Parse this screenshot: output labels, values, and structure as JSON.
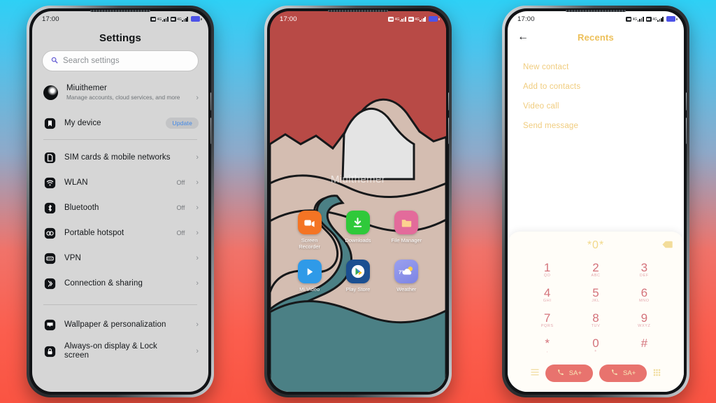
{
  "background": {
    "top_color": "#2ed0f5",
    "bottom_color": "#fa5442"
  },
  "phone1": {
    "name": "settings-phone",
    "statusbar": {
      "time": "17:00",
      "net1": "4G",
      "net2": "4G",
      "battery_color": "#4d53e8"
    },
    "title": "Settings",
    "search": {
      "placeholder": "Search settings",
      "icon": "search-icon"
    },
    "account": {
      "name": "Miuithemer",
      "subtitle": "Manage accounts, cloud services, and more"
    },
    "device": {
      "label": "My device",
      "badge": "Update"
    },
    "items": [
      {
        "label": "SIM cards & mobile networks",
        "value": "",
        "icon": "sim-card-icon"
      },
      {
        "label": "WLAN",
        "value": "Off",
        "icon": "wifi-icon"
      },
      {
        "label": "Bluetooth",
        "value": "Off",
        "icon": "bluetooth-icon"
      },
      {
        "label": "Portable hotspot",
        "value": "Off",
        "icon": "hotspot-icon"
      },
      {
        "label": "VPN",
        "value": "",
        "icon": "vpn-icon"
      },
      {
        "label": "Connection & sharing",
        "value": "",
        "icon": "connection-sharing-icon"
      }
    ],
    "items2": [
      {
        "label": "Wallpaper & personalization",
        "value": "",
        "icon": "wallpaper-icon"
      },
      {
        "label": "Always-on display & Lock screen",
        "value": "",
        "icon": "lock-icon"
      }
    ]
  },
  "phone2": {
    "name": "home-screen-phone",
    "statusbar": {
      "time": "17:00",
      "net1": "4G",
      "net2": "4G",
      "battery_color": "#4d53e8"
    },
    "wallpaper_watermark": "Miuithemer",
    "wallpaper_colors": {
      "sky": "#b84a46",
      "mountain": "#d4bdb1",
      "snow": "#e4e4e4",
      "water": "#4b8085"
    },
    "apps": [
      {
        "label": "Screen Recorder",
        "icon": "video-camera-icon",
        "bg": "#f47424"
      },
      {
        "label": "Downloads",
        "icon": "download-arrow-icon",
        "bg": "#2fc93a"
      },
      {
        "label": "File Manager",
        "icon": "folder-icon",
        "bg": "#e36b9b"
      },
      {
        "label": "Mi Video",
        "icon": "play-triangle-icon",
        "bg": "#2f9ae8"
      },
      {
        "label": "Play Store",
        "icon": "play-store-icon",
        "bg": "#1b4f91"
      },
      {
        "label": "Weather",
        "icon": "weather-sun-cloud-icon",
        "bg": "#8d93e8",
        "temp": "7°"
      }
    ]
  },
  "phone3": {
    "name": "dialer-phone",
    "statusbar": {
      "time": "17:00",
      "net1": "4G",
      "net2": "4G",
      "battery_color": "#4d53e8"
    },
    "header": {
      "back": "←",
      "title": "Recents"
    },
    "menu": [
      "New contact",
      "Add to contacts",
      "Video call",
      "Send message"
    ],
    "dial": {
      "number": "*0*",
      "backspace_icon": "backspace-icon"
    },
    "keys": [
      {
        "digit": "1",
        "letters": "QO"
      },
      {
        "digit": "2",
        "letters": "ABC"
      },
      {
        "digit": "3",
        "letters": "DEF"
      },
      {
        "digit": "4",
        "letters": "GHI"
      },
      {
        "digit": "5",
        "letters": "JKL"
      },
      {
        "digit": "6",
        "letters": "MNO"
      },
      {
        "digit": "7",
        "letters": "PQRS"
      },
      {
        "digit": "8",
        "letters": "TUV"
      },
      {
        "digit": "9",
        "letters": "WXYZ"
      },
      {
        "digit": "*",
        "letters": ","
      },
      {
        "digit": "0",
        "letters": "+"
      },
      {
        "digit": "#",
        "letters": ""
      }
    ],
    "call_buttons": [
      {
        "label": "SA+",
        "icon": "phone-call-icon"
      },
      {
        "label": "SA+",
        "icon": "phone-call-icon"
      }
    ],
    "bottom_icons": {
      "left": "menu-icon",
      "right": "keypad-icon"
    },
    "accent": "#e8736e"
  }
}
